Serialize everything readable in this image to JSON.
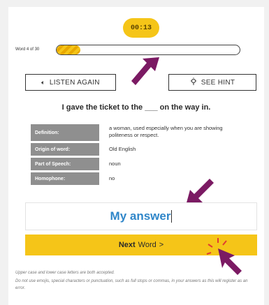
{
  "timer": {
    "value": "00:13"
  },
  "progress": {
    "word_label": "Word 4 of 30",
    "fraction": 0.13,
    "fill_color": "#f5c518"
  },
  "buttons": {
    "listen": {
      "label": "LISTEN AGAIN",
      "icon": "speaker-icon"
    },
    "hint": {
      "label": "SEE HINT",
      "icon": "lightbulb-icon"
    }
  },
  "sentence": "I gave the ticket to the ___ on the way in.",
  "word_info": [
    {
      "label": "Definition:",
      "value": "a woman, used especially when you are showing politeness or respect."
    },
    {
      "label": "Origin of word:",
      "value": "Old English"
    },
    {
      "label": "Part of Speech:",
      "value": "noun"
    },
    {
      "label": "Homophone:",
      "value": "no"
    }
  ],
  "answer": {
    "value": "My answer"
  },
  "next_button": {
    "bold": "Next",
    "rest": "Word",
    "chevron": ">"
  },
  "notes": [
    "Upper case and lower case letters are both accepted.",
    "Do not use emojis, special characters or punctuation, such as full stops or commas, in your answers as this will register as an error."
  ],
  "colors": {
    "accent": "#f5c518",
    "answer_text": "#2f86c9",
    "arrow": "#7b1a63",
    "label_bg": "#8f8f8f"
  }
}
